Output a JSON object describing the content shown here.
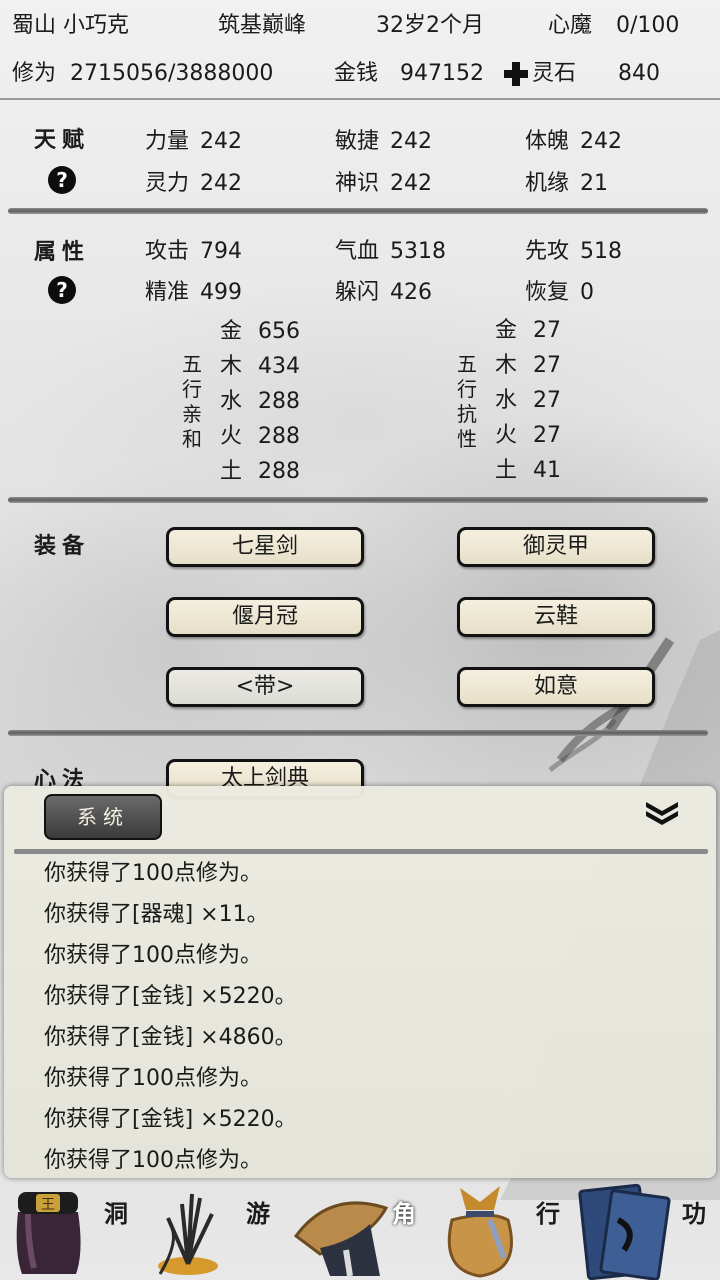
{
  "header": {
    "name": "蜀山 小巧克",
    "realm": "筑基巅峰",
    "age": "32岁2个月",
    "demon_label": "心魔",
    "demon_value": "0/100",
    "cultivation_label": "修为",
    "cultivation_value": "2715056/3888000",
    "money_label": "金钱",
    "money_value": "947152",
    "stone_label": "灵石",
    "stone_value": "840"
  },
  "talent": {
    "title": "天赋",
    "help": "?",
    "stats": [
      {
        "label": "力量",
        "value": "242"
      },
      {
        "label": "敏捷",
        "value": "242"
      },
      {
        "label": "体魄",
        "value": "242"
      },
      {
        "label": "灵力",
        "value": "242"
      },
      {
        "label": "神识",
        "value": "242"
      },
      {
        "label": "机缘",
        "value": "21"
      }
    ]
  },
  "attributes": {
    "title": "属性",
    "help": "?",
    "stats": [
      {
        "label": "攻击",
        "value": "794"
      },
      {
        "label": "气血",
        "value": "5318"
      },
      {
        "label": "先攻",
        "value": "518"
      },
      {
        "label": "精准",
        "value": "499"
      },
      {
        "label": "躲闪",
        "value": "426"
      },
      {
        "label": "恢复",
        "value": "0"
      }
    ],
    "affinity_title": [
      "五",
      "行",
      "亲",
      "和"
    ],
    "affinity": [
      {
        "label": "金",
        "value": "656"
      },
      {
        "label": "木",
        "value": "434"
      },
      {
        "label": "水",
        "value": "288"
      },
      {
        "label": "火",
        "value": "288"
      },
      {
        "label": "土",
        "value": "288"
      }
    ],
    "resist_title": [
      "五",
      "行",
      "抗",
      "性"
    ],
    "resist": [
      {
        "label": "金",
        "value": "27"
      },
      {
        "label": "木",
        "value": "27"
      },
      {
        "label": "水",
        "value": "27"
      },
      {
        "label": "火",
        "value": "27"
      },
      {
        "label": "土",
        "value": "41"
      }
    ]
  },
  "equipment": {
    "title": "装备",
    "slots": [
      "七星剑",
      "御灵甲",
      "偃月冠",
      "云鞋",
      "<带>",
      "如意"
    ]
  },
  "technique": {
    "title": "心法",
    "slot": "太上剑典"
  },
  "log_panel": {
    "tab": "系统",
    "messages": [
      "你获得了100点修为。",
      "你获得了[器魂] ×11。",
      "你获得了100点修为。",
      "你获得了[金钱] ×5220。",
      "你获得了[金钱] ×4860。",
      "你获得了100点修为。",
      "你获得了[金钱] ×5220。",
      "你获得了100点修为。"
    ]
  },
  "nav": {
    "items": [
      "洞",
      "游",
      "角",
      "行",
      "功"
    ],
    "active": "角",
    "bag_badge": "王"
  },
  "colors": {
    "ink": "#1b1b1b",
    "button_fill": "#efe9d6",
    "panel": "#ebeae0",
    "tab_dark": "#4a4a4a",
    "nav_active": "#ffffff"
  },
  "icons": [
    "plus-stone-icon",
    "help-icon",
    "collapse-chevron-icon",
    "bag-icon",
    "grass-icon",
    "hat-character-icon",
    "treasure-bag-icon",
    "books-icon"
  ]
}
